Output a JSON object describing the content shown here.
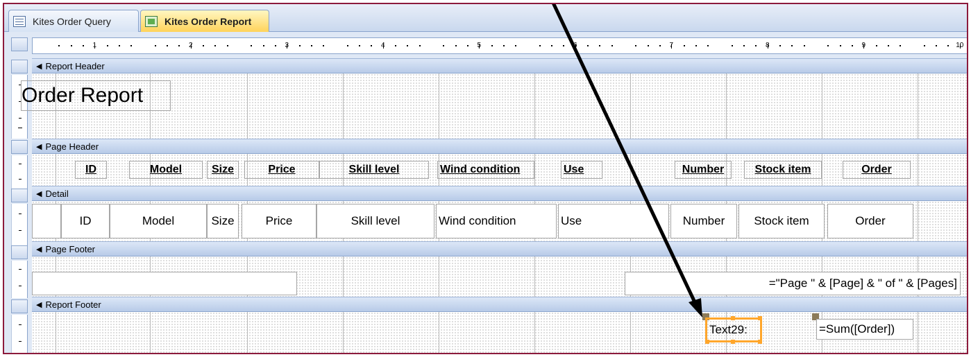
{
  "tabs": [
    {
      "label": "Kites Order Query",
      "icon": "query-icon"
    },
    {
      "label": "Kites Order Report",
      "icon": "report-icon",
      "active": true
    }
  ],
  "ruler": {
    "numbers": [
      "1",
      "2",
      "3",
      "4",
      "5",
      "6",
      "7",
      "8",
      "9",
      "10"
    ]
  },
  "sections": {
    "report_header": "Report Header",
    "page_header": "Page Header",
    "detail": "Detail",
    "page_footer": "Page Footer",
    "report_footer": "Report Footer"
  },
  "report_header": {
    "title": "Order Report"
  },
  "page_header": {
    "labels": [
      "ID",
      "Model",
      "Size",
      "Price",
      "Skill level",
      "Wind condition",
      "Use",
      "Number",
      "Stock item",
      "Order"
    ]
  },
  "detail": {
    "fields": [
      "ID",
      "Model",
      "Size",
      "Price",
      "Skill level",
      "Wind condition",
      "Use",
      "Number",
      "Stock item",
      "Order"
    ]
  },
  "page_footer": {
    "page_expression": "=\"Page \" & [Page] & \" of \" & [Pages]"
  },
  "report_footer": {
    "text_label": "Text29:",
    "sum_expression": "=Sum([Order])"
  },
  "colors": {
    "frame_border": "#8c1a3c",
    "active_tab": "#ffd35a",
    "selection": "#ffa62b",
    "arrow": "#000000"
  }
}
